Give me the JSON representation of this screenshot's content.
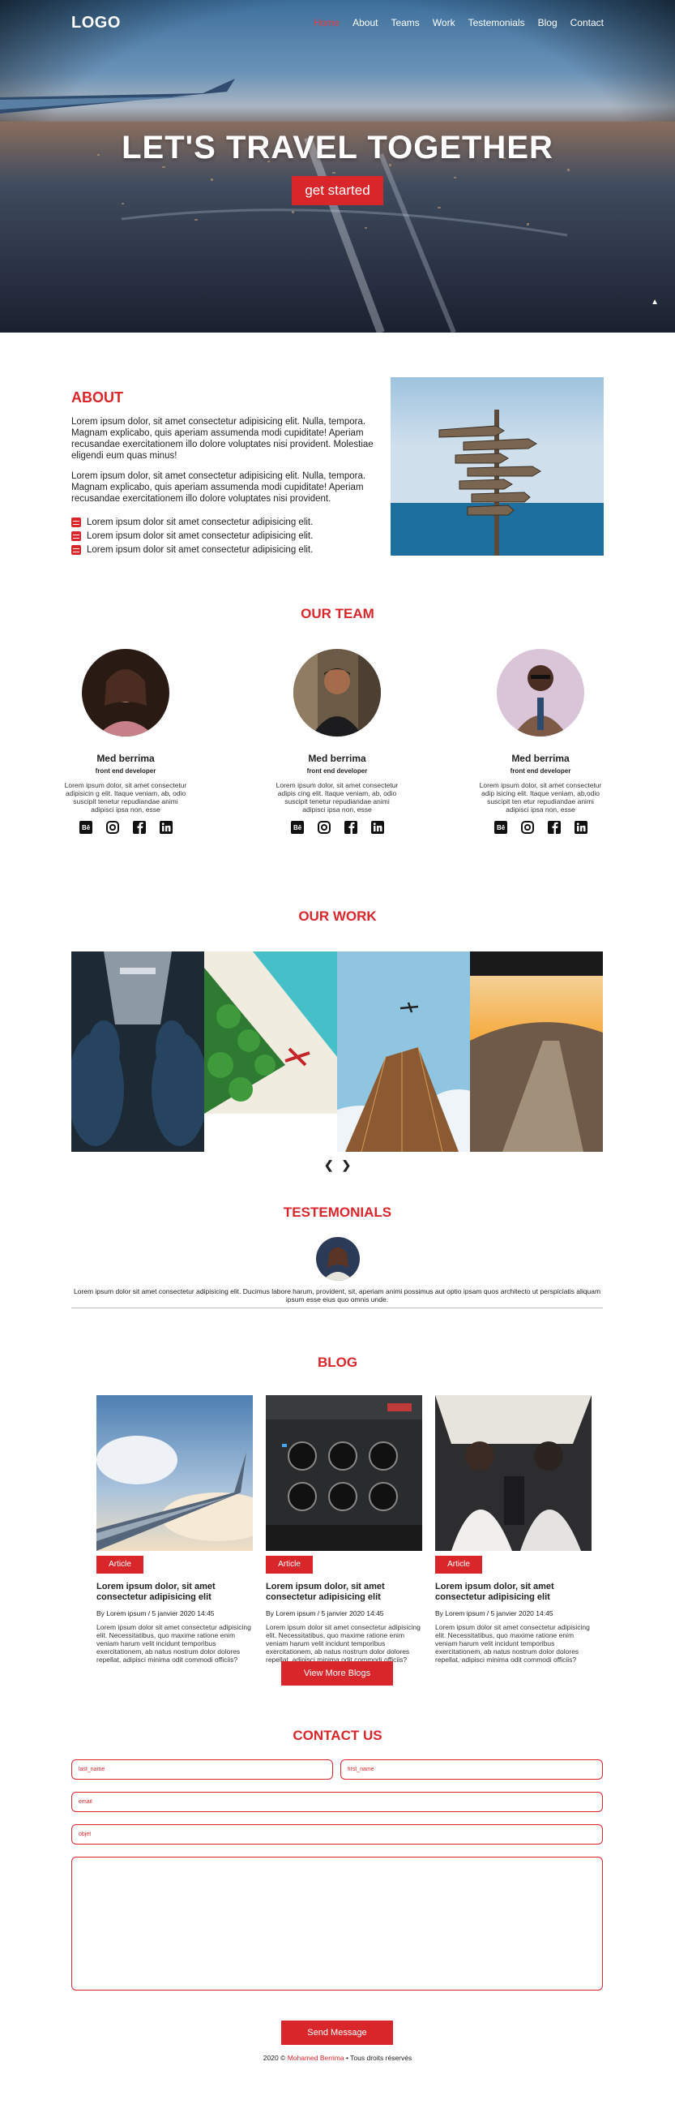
{
  "nav": {
    "logo": "LOGO",
    "items": [
      "Home",
      "About",
      "Teams",
      "Work",
      "Testemonials",
      "Blog",
      "Contact"
    ]
  },
  "hero": {
    "title": "LET'S TRAVEL TOGETHER",
    "cta": "get started",
    "scroll_icon": "caret-up-icon"
  },
  "about": {
    "heading": "ABOUT",
    "para1": "Lorem ipsum dolor, sit amet consectetur adipisicing elit. Nulla, tempora. Magnam explicabo, quis aperiam assumenda modi cupiditate! Aperiam recusandae exercitationem illo dolore voluptates nisi provident. Molestiae eligendi eum quas minus!",
    "para2": "Lorem ipsum dolor, sit amet consectetur adipisicing elit. Nulla, tempora. Magnam explicabo, quis aperiam assumenda modi cupiditate! Aperiam recusandae exercitationem illo dolore voluptates nisi provident.",
    "list": [
      "Lorem ipsum dolor sit amet consectetur adipisicing elit.",
      "Lorem ipsum dolor sit amet consectetur adipisicing elit.",
      "Lorem ipsum dolor sit amet consectetur adipisicing elit."
    ],
    "bullet_icon": "list-bullet-icon",
    "image": "signpost-by-sea-photo"
  },
  "team": {
    "heading": "OUR TEAM",
    "members": [
      {
        "name": "Med berrima",
        "role": "front end developer",
        "desc": "Lorem ipsum dolor, sit amet consectetur adipisicin g elit. Itaque veniam, ab, odio suscipit tenetur repudiandae animi adipisci ipsa non, esse"
      },
      {
        "name": "Med berrima",
        "role": "front end developer",
        "desc": "Lorem ipsum dolor, sit amet consectetur adipis cing elit. Itaque veniam, ab, odio suscipit tenetur repudiandae animi adipisci ipsa non, esse"
      },
      {
        "name": "Med berrima",
        "role": "front end developer",
        "desc": "Lorem ipsum dolor, sit amet consectetur adip isicing elit. Itaque veniam, ab,odio suscipit ten etur repudiandae animi adipisci ipsa non, esse"
      }
    ],
    "social_icons": [
      "behance-icon",
      "instagram-icon",
      "facebook-icon",
      "linkedin-icon"
    ]
  },
  "work": {
    "heading": "OUR WORK",
    "images": [
      "airplane-cabin-seats-photo",
      "tropical-beach-seaplane-photo",
      "skyscraper-and-plane-photo",
      "cockpit-sunset-photo"
    ],
    "prev_icon": "chevron-left-icon",
    "next_icon": "chevron-right-icon"
  },
  "testimonials": {
    "heading": "TESTEMONIALS",
    "quote": "Lorem ipsum dolor sit amet consectetur adipisicing elit. Ducimus labore harum, provident, sit, aperiam animi possimus aut optio ipsam quos architecto ut perspiciatis aliquam ipsum esse eius quo omnis unde."
  },
  "blog": {
    "heading": "BLOG",
    "posts": [
      {
        "tag": "Article",
        "title": "Lorem ipsum dolor, sit amet consectetur adipisicing elit",
        "meta": "By Lorem ipsum / 5 janvier 2020 14:45",
        "excerpt": "Lorem ipsum dolor sit amet consectetur adipisicing elit. Necessitatibus, quo maxime ratione enim veniam harum velit incidunt temporibus exercitationem, ab natus nostrum dolor dolores repellat, adipisci minima odit commodi officiis?",
        "image": "airplane-wing-clouds-photo"
      },
      {
        "tag": "Article",
        "title": "Lorem ipsum dolor, sit amet consectetur adipisicing elit",
        "meta": "By Lorem ipsum / 5 janvier 2020 14:45",
        "excerpt": "Lorem ipsum dolor sit amet consectetur adipisicing elit. Necessitatibus, quo maxime ratione enim veniam harum velit incidunt temporibus exercitationem, ab natus nostrum dolor dolores repellat, adipisci minima odit commodi officiis?",
        "image": "cockpit-instruments-photo"
      },
      {
        "tag": "Article",
        "title": "Lorem ipsum dolor, sit amet consectetur adipisicing elit",
        "meta": "By Lorem ipsum / 5 janvier 2020 14:45",
        "excerpt": "Lorem ipsum dolor sit amet consectetur adipisicing elit. Necessitatibus, quo maxime ratione enim veniam harum velit incidunt temporibus exercitationem, ab natus nostrum dolor dolores repellat, adipisci minima odit commodi officiis?",
        "image": "pilots-in-cockpit-photo"
      }
    ],
    "more": "View More Blogs"
  },
  "contact": {
    "heading": "CONTACT US",
    "first_name": "last_name",
    "last_name": "first_name",
    "email": "email",
    "subject": "objet",
    "message": "",
    "send": "Send Message"
  },
  "footer": {
    "prefix": "2020 ©",
    "author": "Mohamed Berrima",
    "suffix": "• Tous droits réservés"
  },
  "colors": {
    "accent": "#d9262b"
  }
}
